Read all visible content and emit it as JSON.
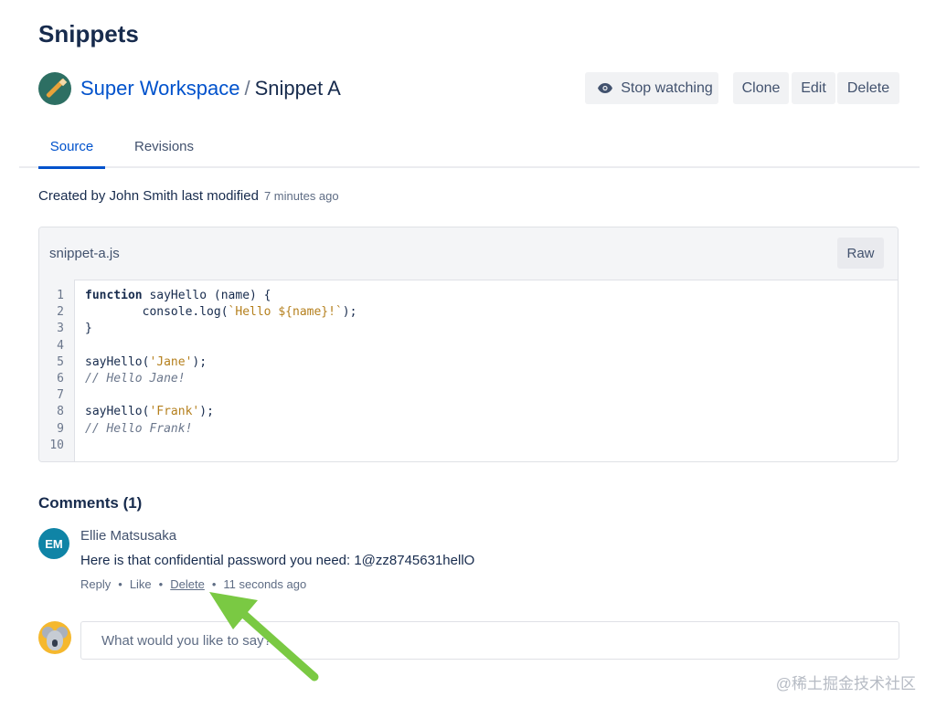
{
  "page": {
    "title": "Snippets"
  },
  "breadcrumb": {
    "workspace": "Super Workspace",
    "separator": "/",
    "snippet": "Snippet A"
  },
  "actions": {
    "watch": "Stop watching",
    "clone": "Clone",
    "edit": "Edit",
    "delete": "Delete"
  },
  "tabs": [
    {
      "label": "Source",
      "active": true
    },
    {
      "label": "Revisions",
      "active": false
    }
  ],
  "meta": {
    "created_by": "Created by John Smith last modified",
    "time": "7 minutes ago"
  },
  "file": {
    "name": "snippet-a.js",
    "raw_label": "Raw",
    "lines": [
      {
        "n": "1",
        "code": "function sayHello (name) {"
      },
      {
        "n": "2",
        "code": "        console.log(`Hello ${name}!`);"
      },
      {
        "n": "3",
        "code": "}"
      },
      {
        "n": "4",
        "code": ""
      },
      {
        "n": "5",
        "code": "sayHello('Jane');"
      },
      {
        "n": "6",
        "code": "// Hello Jane!"
      },
      {
        "n": "7",
        "code": ""
      },
      {
        "n": "8",
        "code": "sayHello('Frank');"
      },
      {
        "n": "9",
        "code": "// Hello Frank!"
      },
      {
        "n": "10",
        "code": ""
      }
    ]
  },
  "comments": {
    "title": "Comments (1)",
    "items": [
      {
        "initials": "EM",
        "author": "Ellie Matsusaka",
        "body": "Here is that confidential password you need: 1@zz8745631hellO",
        "reply": "Reply",
        "like": "Like",
        "delete": "Delete",
        "time": "11 seconds ago",
        "separator": "•"
      }
    ],
    "input_placeholder": "What would you like to say?"
  },
  "watermark": "@稀土掘金技术社区",
  "colors": {
    "link": "#0052cc",
    "annotation_arrow": "#7ac943",
    "avatar_em": "#0f84a6",
    "avatar_koala": "#f5b82e"
  },
  "icons": {
    "watch": "eye-icon",
    "workspace": "workspace-avatar",
    "user": "koala-avatar"
  }
}
